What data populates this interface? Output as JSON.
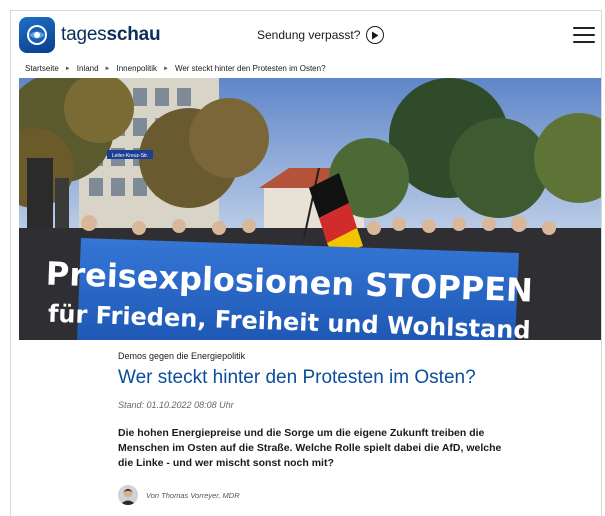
{
  "header": {
    "brand_prefix": "tages",
    "brand_suffix": "schau",
    "sendung_label": "Sendung verpasst?",
    "menu_icon": "hamburger-menu-icon",
    "logo_icon": "tagesschau-globe-logo",
    "play_icon": "play-icon"
  },
  "breadcrumb": {
    "items": [
      "Startseite",
      "Inland",
      "Innenpolitik",
      "Wer steckt hinter den Protesten im Osten?"
    ],
    "separator": "►"
  },
  "hero": {
    "banner_line1": "Preisexplosionen STOPPEN",
    "banner_line2": "für Frieden, Freiheit und Wohlstand",
    "street_sign": "Leiter-Kreuz-Str."
  },
  "article": {
    "kicker": "Demos gegen die Energiepolitik",
    "headline": "Wer steckt hinter den Protesten im Osten?",
    "stand": "Stand: 01.10.2022 08:08 Uhr",
    "teaser": "Die hohen Energiepreise und die Sorge um die eigene Zukunft treiben die Menschen im Osten auf die Straße. Welche Rolle spielt dabei die AfD, welche die Linke - und wer mischt sonst noch mit?"
  },
  "author": {
    "name": "Von Thomas Vorreyer, MDR"
  },
  "colors": {
    "brand_blue": "#0a3e8a",
    "headline_blue": "#0a4d9c",
    "banner_blue": "#2f6fd0"
  }
}
